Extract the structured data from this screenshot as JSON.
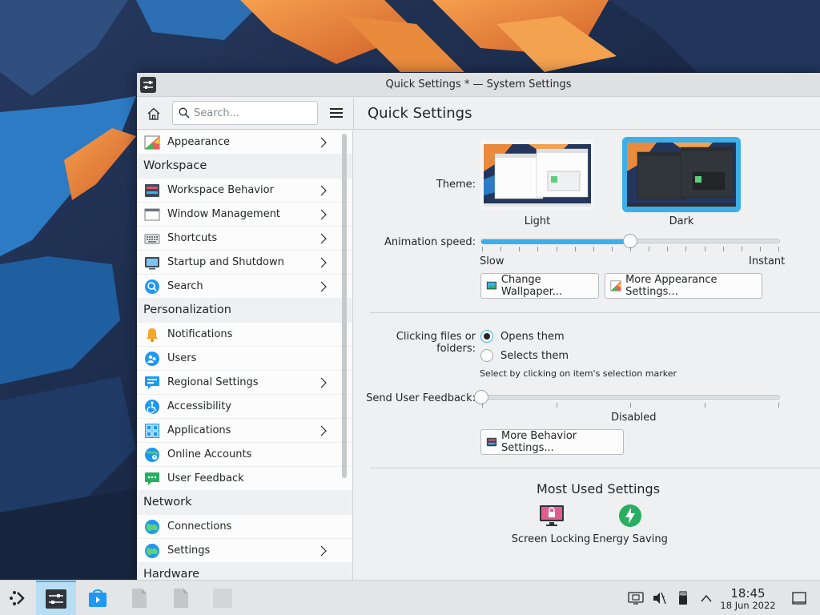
{
  "window": {
    "title": "Quick Settings * — System Settings"
  },
  "search": {
    "placeholder": "Search..."
  },
  "page": {
    "title": "Quick Settings"
  },
  "sidebar": {
    "top_item": "Appearance",
    "sections": {
      "workspace": "Workspace",
      "personalization": "Personalization",
      "network": "Network",
      "hardware": "Hardware"
    },
    "workspace_items": [
      "Workspace Behavior",
      "Window Management",
      "Shortcuts",
      "Startup and Shutdown",
      "Search"
    ],
    "personalization_items": [
      "Notifications",
      "Users",
      "Regional Settings",
      "Accessibility",
      "Applications",
      "Online Accounts",
      "User Feedback"
    ],
    "network_items": [
      "Connections",
      "Settings"
    ]
  },
  "quick": {
    "theme_label": "Theme:",
    "theme_light": "Light",
    "theme_dark": "Dark",
    "selected_theme": "Dark",
    "anim_label": "Animation speed:",
    "anim_slow": "Slow",
    "anim_instant": "Instant",
    "anim_value": 0.5,
    "change_wallpaper": "Change Wallpaper...",
    "more_appearance": "More Appearance Settings...",
    "click_label": "Clicking files or folders:",
    "opens_them": "Opens them",
    "selects_them": "Selects them",
    "select_hint": "Select by clicking on item's selection marker",
    "feedback_label": "Send User Feedback:",
    "feedback_value_text": "Disabled",
    "feedback_value": 0,
    "more_behavior": "More Behavior Settings...",
    "most_used_title": "Most Used Settings",
    "screen_locking": "Screen Locking",
    "energy_saving": "Energy Saving"
  },
  "taskbar": {
    "time": "18:45",
    "date": "18 Jun 2022"
  },
  "colors": {
    "accent": "#3daee9",
    "window_bg": "#eff0f1",
    "panel": "#e3e5e7"
  }
}
